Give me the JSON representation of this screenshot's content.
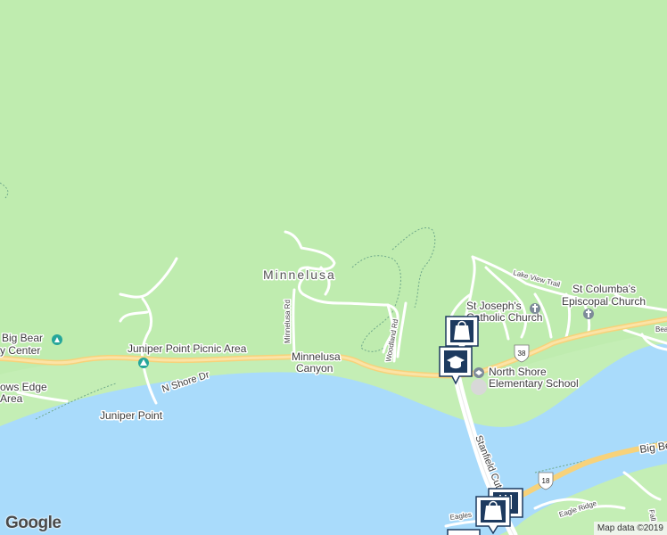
{
  "map": {
    "place_name": "Minnelusa",
    "labels": {
      "lake_view_trail": "Lake View Trail",
      "st_columbas": [
        "St Columba's",
        "Episcopal Church"
      ],
      "st_josephs": [
        "St Joseph's",
        "Catholic Church"
      ],
      "north_shore_school": [
        "North Shore",
        "Elementary School"
      ],
      "minnelusa_canyon": [
        "Minnelusa",
        "Canyon"
      ],
      "juniper_point_picnic": "Juniper Point Picnic Area",
      "big_bear_center": [
        "Big Bear",
        "y Center"
      ],
      "n_shore_dr": "N Shore Dr",
      "minnelusa_rd": "Minnelusa Rd",
      "woodland_rd": "Woodland Rd",
      "stanfield_cutoff": "Stanfield Cutoff",
      "ows_edge_area": [
        "ows Edge",
        "Area"
      ],
      "juniper_point": "Juniper Point",
      "big_bea": "Big Bea",
      "eagle_ridge": "Eagle Ridge",
      "eagles": "Eagles",
      "bea_edge": "Bea",
      "fall_edge": "Fall"
    },
    "shields": {
      "route_38": "38",
      "route_18": "18"
    },
    "colors": {
      "forest": "#bfecaf",
      "water": "#a9dbfb",
      "highway": "#f7d27a",
      "road": "#ffffff",
      "marker": "#1d3a5f"
    },
    "icons": [
      "shopping-bag-icon",
      "graduation-cap-icon",
      "shopping-bag-icon",
      "restaurant-icon",
      "church-icon",
      "school-icon",
      "picnic-icon",
      "park-icon"
    ]
  },
  "footer": {
    "logo": "Google",
    "attribution": "Map data ©2019"
  }
}
